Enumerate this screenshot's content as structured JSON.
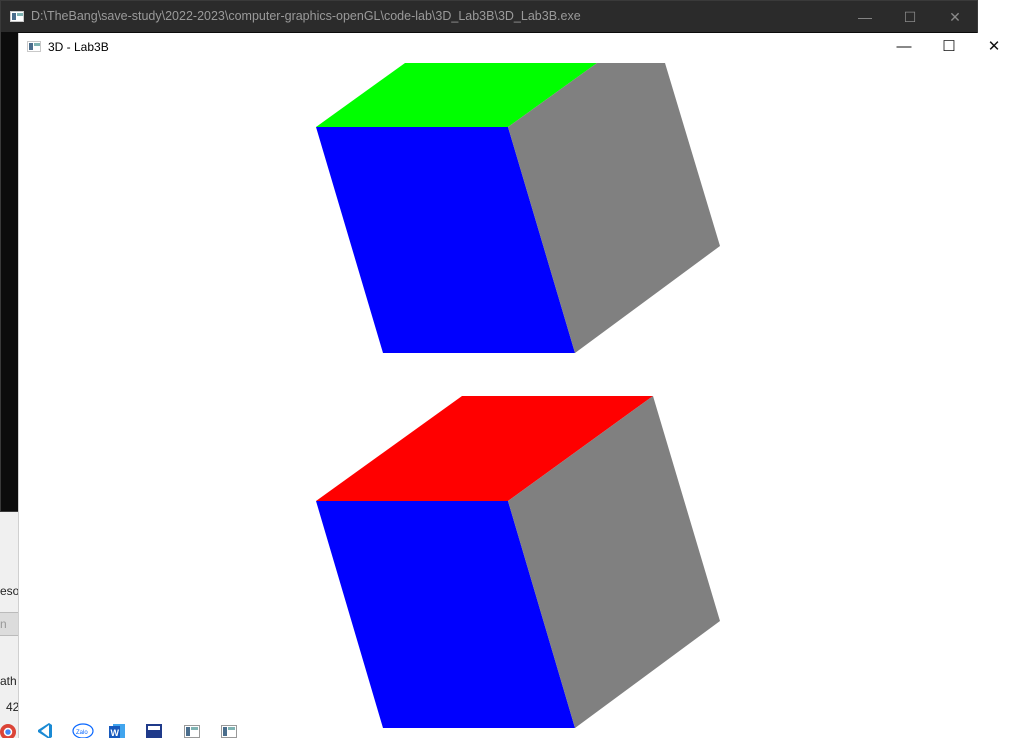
{
  "console_window": {
    "title": "D:\\TheBang\\save-study\\2022-2023\\computer-graphics-openGL\\code-lab\\3D_Lab3B\\3D_Lab3B.exe",
    "icon": "app-window-icon",
    "controls": {
      "minimize": "—",
      "maximize": "☐",
      "close": "✕"
    }
  },
  "gl_window": {
    "title": "3D - Lab3B",
    "icon": "app-window-icon",
    "controls": {
      "minimize": "—",
      "maximize": "☐",
      "close": "✕"
    }
  },
  "scene": {
    "cubes": [
      {
        "name": "upper-cube",
        "colors": {
          "top": "#00ff00",
          "front": "#0000ff",
          "side": "#808080"
        }
      },
      {
        "name": "lower-cube",
        "colors": {
          "top": "#ff0000",
          "front": "#0000ff",
          "side": "#808080"
        }
      }
    ]
  },
  "left_panel": {
    "snippets": [
      "esou",
      "n",
      "ath",
      "42"
    ]
  },
  "taskbar": {
    "icons": [
      "chrome-icon",
      "vscode-icon",
      "zalo-icon",
      "word-icon",
      "obs-icon",
      "app-window-icon",
      "app-window-icon"
    ],
    "zalo_label": "Zalo",
    "word_label": "W"
  }
}
